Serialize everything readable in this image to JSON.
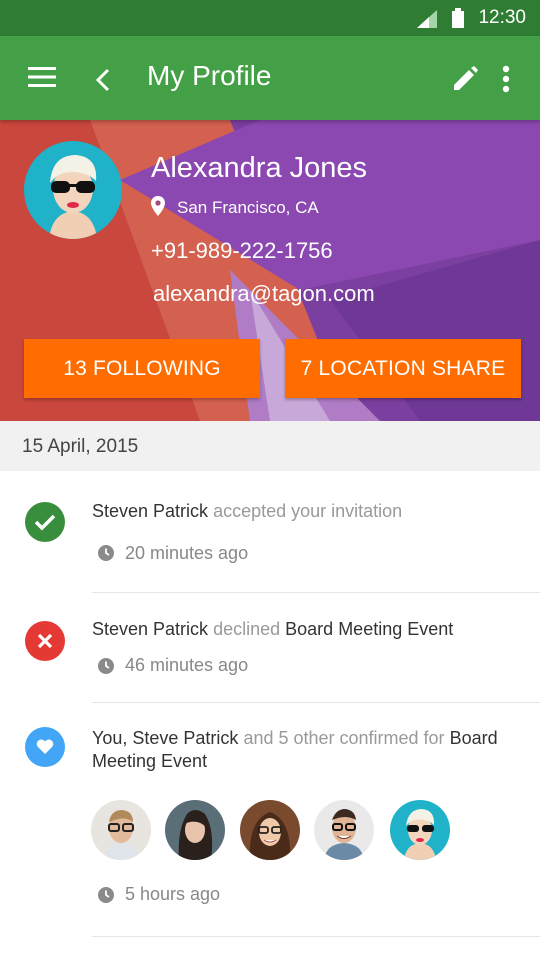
{
  "status_bar": {
    "time": "12:30"
  },
  "app_bar": {
    "title": "My Profile"
  },
  "profile": {
    "name": "Alexandra Jones",
    "location": "San Francisco, CA",
    "phone": "+91-989-222-1756",
    "email": "alexandra@tagon.com",
    "following_label": "13 FOLLOWING",
    "location_share_label": "7 LOCATION SHARE"
  },
  "date_header": "15 April, 2015",
  "activity": [
    {
      "icon": "check-icon",
      "color": "#388e3c",
      "actor": "Steven Patrick",
      "action": "accepted your invitation",
      "object": "",
      "time": "20 minutes ago"
    },
    {
      "icon": "close-icon",
      "color": "#e53935",
      "actor": "Steven Patrick",
      "action": "declined",
      "object": "Board Meeting Event",
      "time": "46 minutes ago"
    },
    {
      "icon": "heart-icon",
      "color": "#42a5f5",
      "actor": "You, Steve Patrick",
      "action": "and 5 other confirmed for",
      "object": "Board Meeting Event",
      "time": "5 hours ago"
    }
  ],
  "colors": {
    "status": "#2e7d32",
    "appbar": "#43a047",
    "accent": "#ff6d00",
    "hero_purple": "#7b3fa0",
    "hero_red": "#c9473c"
  }
}
